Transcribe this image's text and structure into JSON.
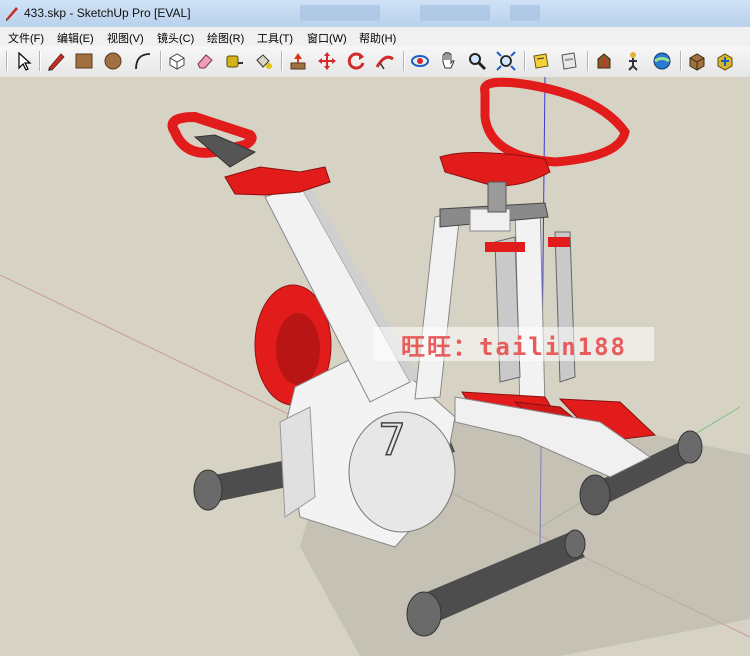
{
  "window": {
    "title": "433.skp - SketchUp Pro [EVAL]"
  },
  "menu": [
    "文件(F)",
    "编辑(E)",
    "视图(V)",
    "镜头(C)",
    "绘图(R)",
    "工具(T)",
    "窗口(W)",
    "帮助(H)"
  ],
  "toolbar": {
    "tools": [
      "select-icon",
      "pencil-icon",
      "rectangle-icon",
      "circle-icon",
      "arc-icon",
      "make-component-icon",
      "eraser-icon",
      "tape-measure-icon",
      "paint-bucket-icon",
      "push-pull-icon",
      "move-icon",
      "rotate-icon",
      "follow-me-icon",
      "orbit-icon",
      "pan-icon",
      "zoom-icon",
      "zoom-extents-icon",
      "scenes-icon",
      "section-icon",
      "walk-icon",
      "look-around-icon",
      "position-camera-icon",
      "3d-warehouse-icon",
      "extension-icon"
    ]
  },
  "viewport": {
    "watermark": "旺旺：tailin188",
    "frame_number": "7"
  },
  "colors": {
    "background": "#d6d3c5",
    "frame_white": "#f2f2f2",
    "accent_red": "#e11a1a",
    "tube_gray": "#5a5a5a"
  }
}
